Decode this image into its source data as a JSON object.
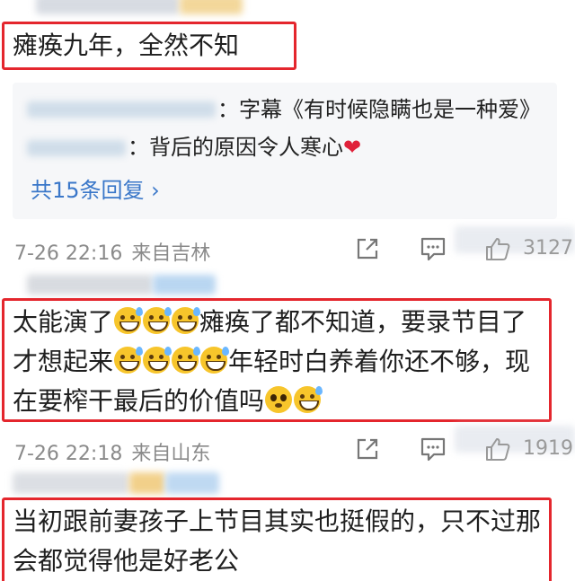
{
  "comment1": {
    "text": "瘫痪九年，全然不知",
    "replies": [
      {
        "text": "：字幕《有时候隐瞒也是一种爱》"
      },
      {
        "text": "：背后的原因令人寒心",
        "heart": "❤"
      }
    ],
    "more_replies": "共15条回复 ›",
    "time": "7-26 22:16",
    "location": "来自吉林",
    "like_count": "3127"
  },
  "comment2": {
    "line1_a": "太能演了",
    "line1_b": "瘫痪了都不知道，要录节目了",
    "line2_a": "才想起来",
    "line2_b": "年轻时白养着你还不够，现",
    "line3_a": "在要榨干最后的价值吗",
    "time": "7-26 22:18",
    "location": "来自山东",
    "like_count": "1919"
  },
  "comment3": {
    "line1": "当初跟前妻孩子上节目其实也挺假的，只不过那",
    "line2": "会都觉得他是好老公"
  },
  "icons": {
    "share": "share-icon",
    "comment": "comment-icon",
    "like": "thumbs-up-icon"
  },
  "colors": {
    "highlight": "#e4262d",
    "link": "#3a77c9",
    "meta": "#8a8a8a"
  }
}
